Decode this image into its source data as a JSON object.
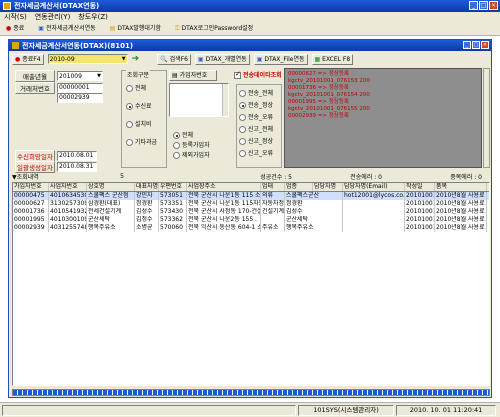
{
  "app": {
    "title": "전자세금계산서(DTAX연동)",
    "menu": [
      "시작(S)",
      "연동관리(Y)",
      "창도우(Z)"
    ],
    "toolbar": [
      {
        "label": "종료",
        "icon": "exit-icon"
      },
      {
        "label": "전자세금계산서연동",
        "icon": "document-icon"
      },
      {
        "label": "DTAX발행대기함",
        "icon": "folder-icon"
      },
      {
        "label": "DTAX로그인Password설정",
        "icon": "key-icon"
      }
    ]
  },
  "child": {
    "title": "전자세금계산서연동(DTAX)(8101)",
    "buttons": {
      "close": "종료F4",
      "search": "검색F6",
      "dtax_link": "DTAX_개별연동",
      "dtax_file": "DTAX_File연동",
      "excel": "EXCEL F8"
    },
    "filters": {
      "company_label": "매출년월",
      "company_value": "201009",
      "account_label": "거래처번호",
      "account_from": "00000001",
      "account_to": "00002939",
      "date1_label": "수신희망일자",
      "date1_value": "2010.08.01",
      "date2_label": "일괄생성일자",
      "date2_value": "2010.08.31",
      "top_select": "2010-09"
    },
    "query": {
      "title": "조회구분",
      "options": [
        "전체",
        "수신료",
        "설치비",
        "기타과금"
      ],
      "selected": 1
    },
    "subscriber": {
      "title": "가입자번호",
      "radio": [
        "전체",
        "등록가입자",
        "제외가입자"
      ],
      "selected": 0
    },
    "sync": {
      "title": "전송데이타조회",
      "options": [
        "전송_전체",
        "전송_정상",
        "전송_오류",
        "신고_전체",
        "신고_정상",
        "신고_오류"
      ],
      "selected": 1
    },
    "log": [
      "00000627 => 정상등록",
      "kgctv_20101001_076153 200",
      "00001736 => 정상등록",
      "kgctv_20101001_076154 200",
      "00001995 => 정상등록",
      "kgctv_20101001_076155 200",
      "00002939 => 정상등록"
    ],
    "summary": {
      "label": "▼조회내역",
      "count": "5",
      "success_label": "성공건수 : 5",
      "fail_label": "전송에러 : 0",
      "dup_label": "중복에러 : 0"
    },
    "table": {
      "columns": [
        "가입자번호",
        "사업자번호",
        "상호명",
        "대표자명",
        "우편번호",
        "사업장주소",
        "업태",
        "업종",
        "담당자명",
        "담당자명(Email)",
        "작성일",
        "품목"
      ],
      "rows": [
        [
          "00000475",
          "4010634530",
          "스쿨팩스 군산점",
          "강민자",
          "573051",
          "전북 군산시 나운1동 115 소랑",
          "의류",
          "스쿨팩스군산",
          "hot12001@lycos.co.kr",
          "20101001",
          "2010년8월 사용료"
        ],
        [
          "00000627",
          "3130257309",
          "삼경환(대표)",
          "정경환",
          "573351",
          "전북 군산시 나운1동 115자동차정비",
          "자동차정비",
          "정경환",
          "",
          "20101001",
          "2010년8월 사용료"
        ],
        [
          "00001736",
          "4010541932",
          "전세건설기계",
          "김성수",
          "573430",
          "전북 군산시 사정동 170-건설",
          "건설기계",
          "김성수",
          "",
          "20101001",
          "2010년8월 사용료"
        ],
        [
          "00001995",
          "4010300109",
          "군산세탁",
          "김정수",
          "573362",
          "전북 군산시 나운2동 155 .",
          "",
          "군산세탁",
          "",
          "20101001",
          "2010년8월 사용료"
        ],
        [
          "00002939",
          "4031255748",
          "행복주유소",
          "소병균",
          "570060",
          "전북 익산시 동산동 604-1 소매업",
          "주유소",
          "행복주유소",
          "",
          "20101001",
          "2010년8월 사용료"
        ]
      ]
    }
  },
  "status": {
    "user": "101SYS(시스템관리자)",
    "datetime": "2010. 10. 01 11:20:41"
  },
  "colors": {
    "titlebar": "#0a246a",
    "log_bg": "#8e8e8e",
    "log_text": "#cc0000",
    "highlight": "#cfe0ff",
    "progress": "#1b5bd6"
  }
}
